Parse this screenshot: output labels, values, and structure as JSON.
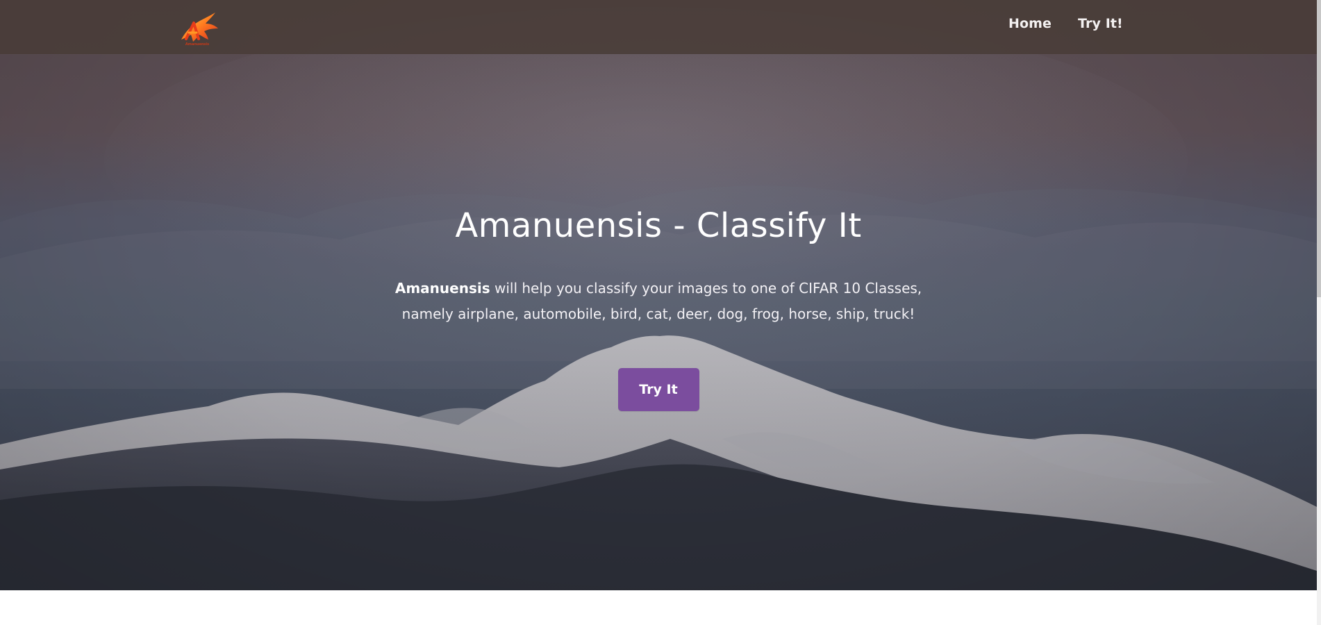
{
  "brand": {
    "logo_text": "Amanuensis"
  },
  "nav": {
    "items": [
      {
        "label": "Home"
      },
      {
        "label": "Try It!"
      }
    ]
  },
  "hero": {
    "title": "Amanuensis - Classify It",
    "description_strong": "Amanuensis",
    "description_rest": " will help you classify your images to one of CIFAR 10 Classes, namely airplane, automobile, bird, cat, deer, dog, frog, horse, ship, truck!",
    "button_label": "Try It"
  },
  "colors": {
    "accent": "#7b4d9e",
    "navbar": "#493c38",
    "text": "#ffffff"
  },
  "icons": {
    "brand": "bird-logo-icon"
  }
}
